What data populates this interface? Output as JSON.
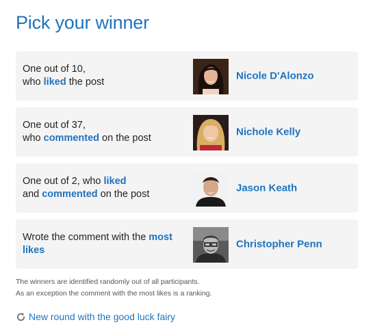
{
  "title": "Pick your winner",
  "rows": [
    {
      "desc": [
        {
          "text": "One out of 10,",
          "hl": false,
          "br": true
        },
        {
          "text": "who ",
          "hl": false
        },
        {
          "text": "liked",
          "hl": true
        },
        {
          "text": " the post",
          "hl": false
        }
      ],
      "winner": "Nicole D'Alonzo",
      "avatar": "female-portrait-dark-hair"
    },
    {
      "desc": [
        {
          "text": "One out of 37,",
          "hl": false,
          "br": true
        },
        {
          "text": "who ",
          "hl": false
        },
        {
          "text": "commented",
          "hl": true
        },
        {
          "text": " on the post",
          "hl": false
        }
      ],
      "winner": "Nichole Kelly",
      "avatar": "female-portrait-blonde"
    },
    {
      "desc": [
        {
          "text": "One out of 2, who ",
          "hl": false
        },
        {
          "text": "liked",
          "hl": true,
          "br": true
        },
        {
          "text": "and ",
          "hl": false
        },
        {
          "text": "commented",
          "hl": true
        },
        {
          "text": " on the post",
          "hl": false
        }
      ],
      "winner": "Jason Keath",
      "avatar": "male-portrait-dark-hair"
    },
    {
      "desc": [
        {
          "text": "Wrote the comment with the ",
          "hl": false
        },
        {
          "text": "most",
          "hl": true,
          "br": true
        },
        {
          "text": "likes",
          "hl": true
        }
      ],
      "winner": "Christopher Penn",
      "avatar": "male-portrait-bw-glasses"
    }
  ],
  "note_lines": [
    "The winners are identified randomly out of all participants.",
    "As an exception the comment with the most likes is a ranking."
  ],
  "new_round_label": "New round with the good luck fairy",
  "new_round_icon": "refresh-icon",
  "colors": {
    "accent": "#1e73be",
    "row_bg": "#f4f4f4"
  }
}
